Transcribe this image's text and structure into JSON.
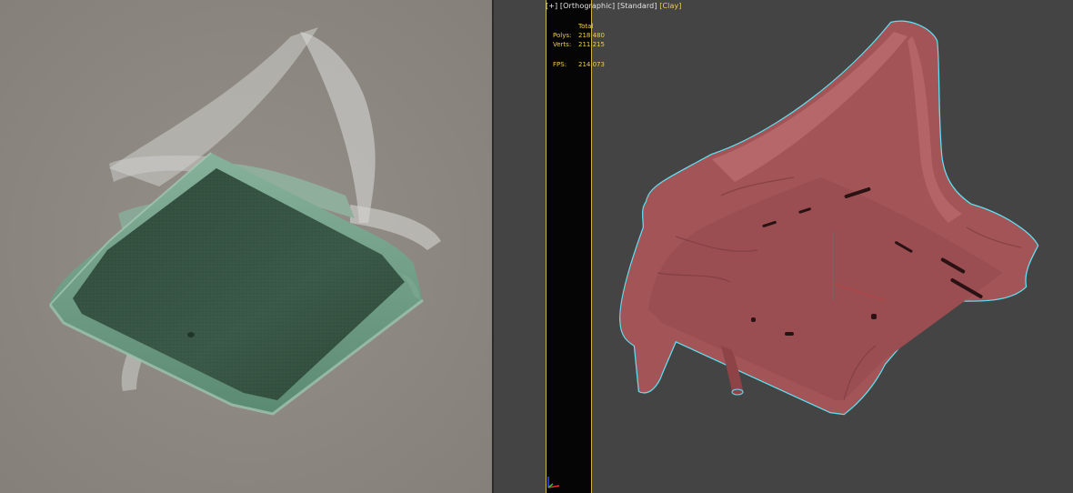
{
  "render_panel": {
    "background": "#8d8882",
    "model_color": "#3f5f4c",
    "model_edge_color": "#7fa791",
    "curtain_color": "#c9c9c6"
  },
  "viewport": {
    "background": "#444444",
    "label": {
      "plus": "[+]",
      "view": "[Orthographic]",
      "shading": "[Standard]",
      "mode": "[Clay]"
    },
    "stats": {
      "header": "Total",
      "polys_label": "Polys:",
      "polys_value": "218 480",
      "verts_label": "Verts:",
      "verts_value": "211 215",
      "fps_label": "FPS:",
      "fps_value": "214,073"
    },
    "clay_color": "#a8585a",
    "selection_color": "#5fe0f0",
    "safe_frame_color": "#c9b64a",
    "gizmo": {
      "x_color": "#e03030",
      "y_color": "#30c030",
      "z_color": "#3050ff"
    }
  }
}
